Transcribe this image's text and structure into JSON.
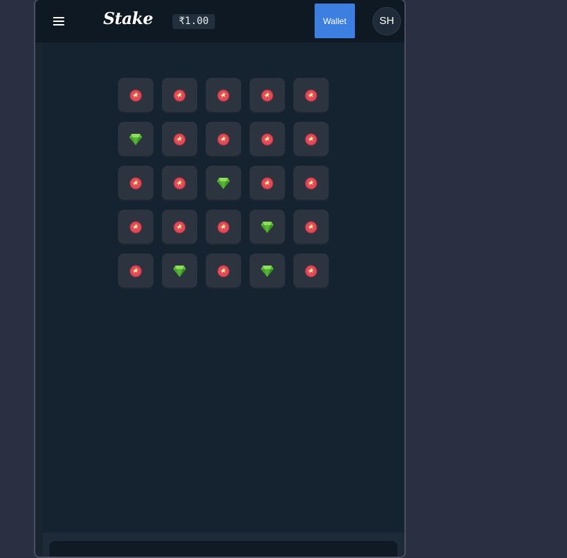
{
  "header": {
    "logo": "Stake",
    "balance": "₹1.00",
    "wallet_label": "Wallet",
    "avatar_initials": "SH"
  },
  "game": {
    "board": [
      [
        "mine",
        "mine",
        "mine",
        "mine",
        "mine"
      ],
      [
        "gem",
        "mine",
        "mine",
        "mine",
        "mine"
      ],
      [
        "mine",
        "mine",
        "gem",
        "mine",
        "mine"
      ],
      [
        "mine",
        "mine",
        "mine",
        "gem",
        "mine"
      ],
      [
        "mine",
        "gem",
        "mine",
        "gem",
        "mine"
      ]
    ]
  },
  "colors": {
    "wallet_button": "#3d7fe0",
    "gem": "#5fbf3a",
    "mine": "#e04a5c"
  }
}
